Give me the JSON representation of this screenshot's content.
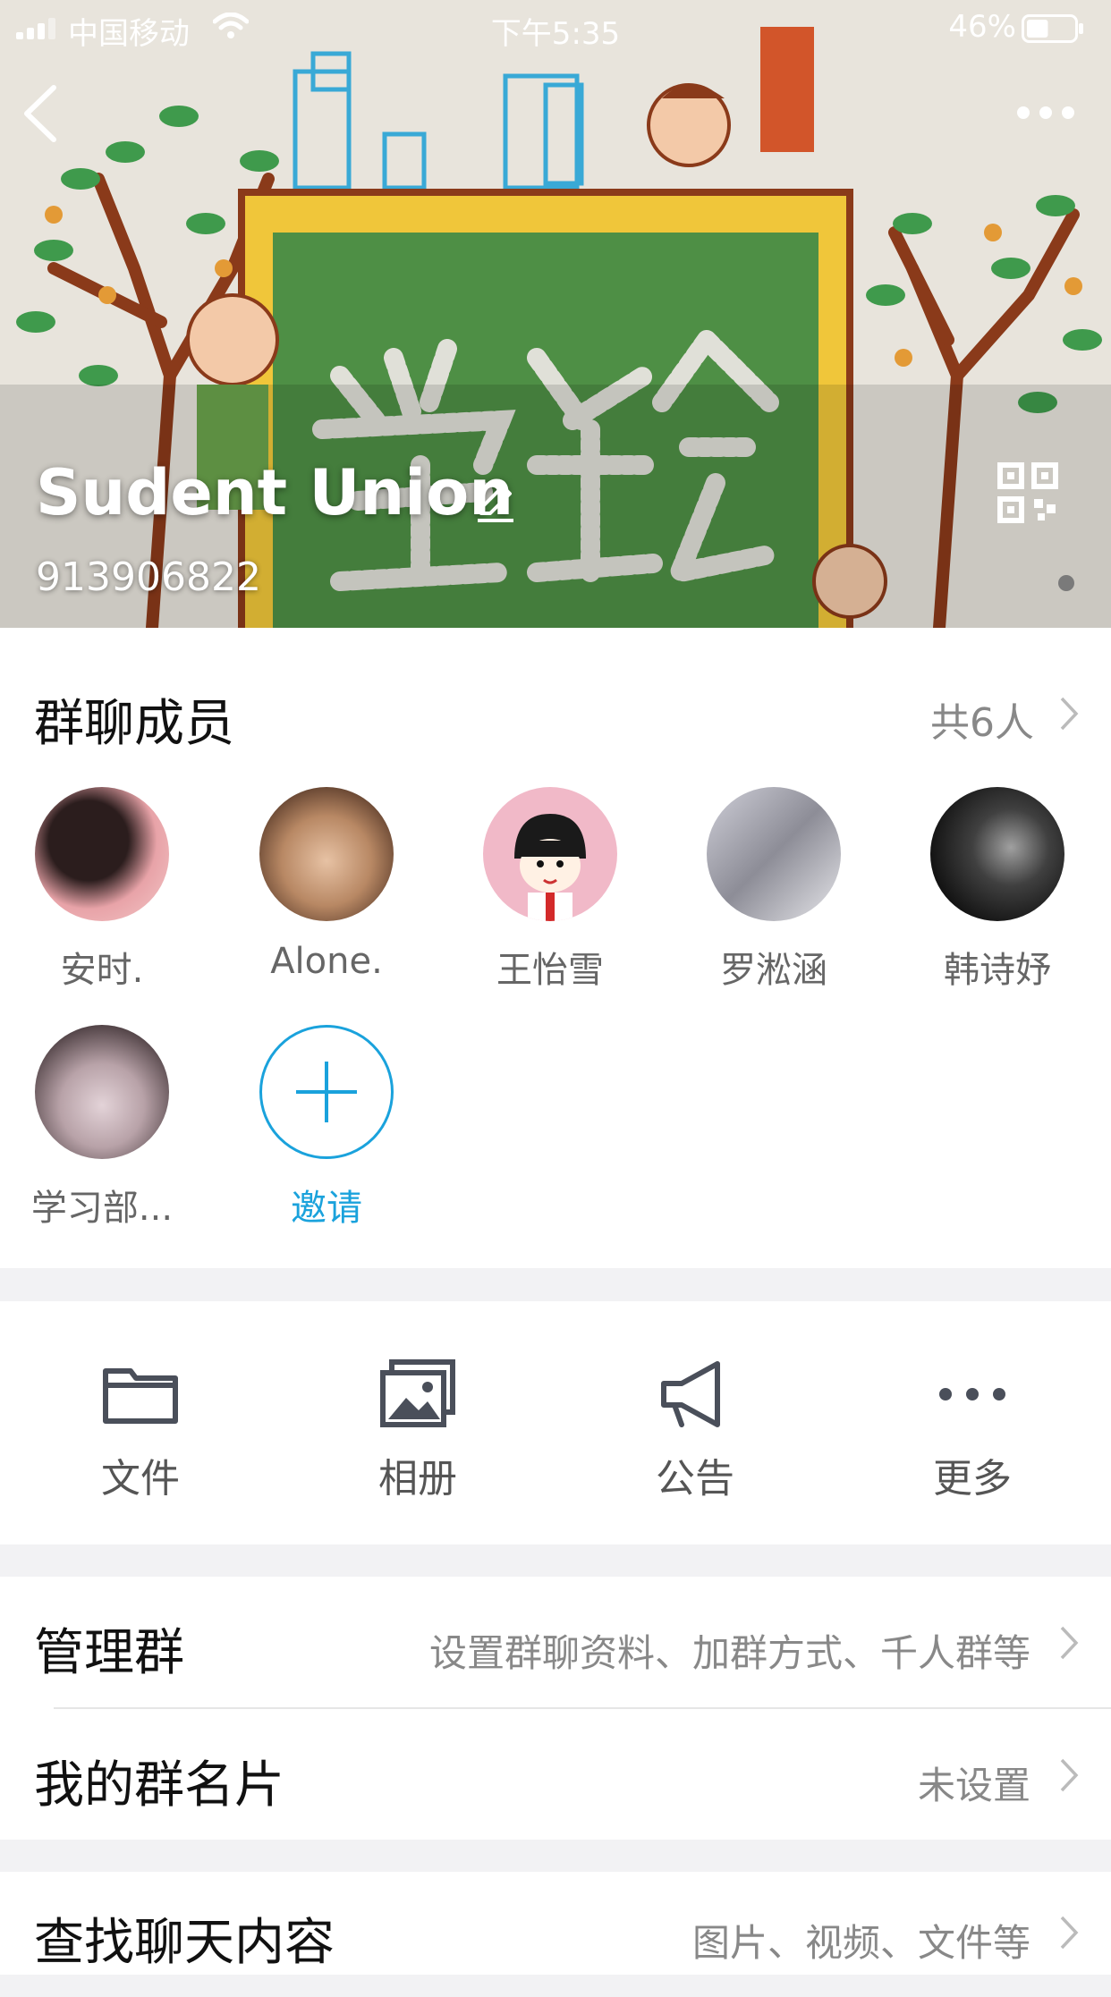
{
  "status_bar": {
    "carrier": "中国移动",
    "time": "下午5:35",
    "battery_percent": "46%",
    "battery_level": 0.46
  },
  "header": {
    "group_name": "Sudent Union",
    "group_id": "913906822",
    "icons": [
      "back-icon",
      "more-icon",
      "edit-icon",
      "qr-code-icon"
    ]
  },
  "members": {
    "title": "群聊成员",
    "count_label": "共6人",
    "list": [
      {
        "name": "安时."
      },
      {
        "name": "Alone."
      },
      {
        "name": "王怡雪"
      },
      {
        "name": "罗淞涵"
      },
      {
        "name": "韩诗妤"
      },
      {
        "name": "学习部..."
      }
    ],
    "invite_label": "邀请"
  },
  "actions": [
    {
      "label": "文件",
      "icon": "folder-icon"
    },
    {
      "label": "相册",
      "icon": "album-icon"
    },
    {
      "label": "公告",
      "icon": "announcement-icon"
    },
    {
      "label": "更多",
      "icon": "more-dots-icon"
    }
  ],
  "settings": {
    "manage": {
      "label": "管理群",
      "value": "设置群聊资料、加群方式、千人群等"
    },
    "card": {
      "label": "我的群名片",
      "value": "未设置"
    },
    "search": {
      "label": "查找聊天内容",
      "value": "图片、视频、文件等"
    }
  },
  "colors": {
    "accent": "#1aa2dc",
    "background": "#f2f2f4",
    "secondary_text": "#888888"
  }
}
